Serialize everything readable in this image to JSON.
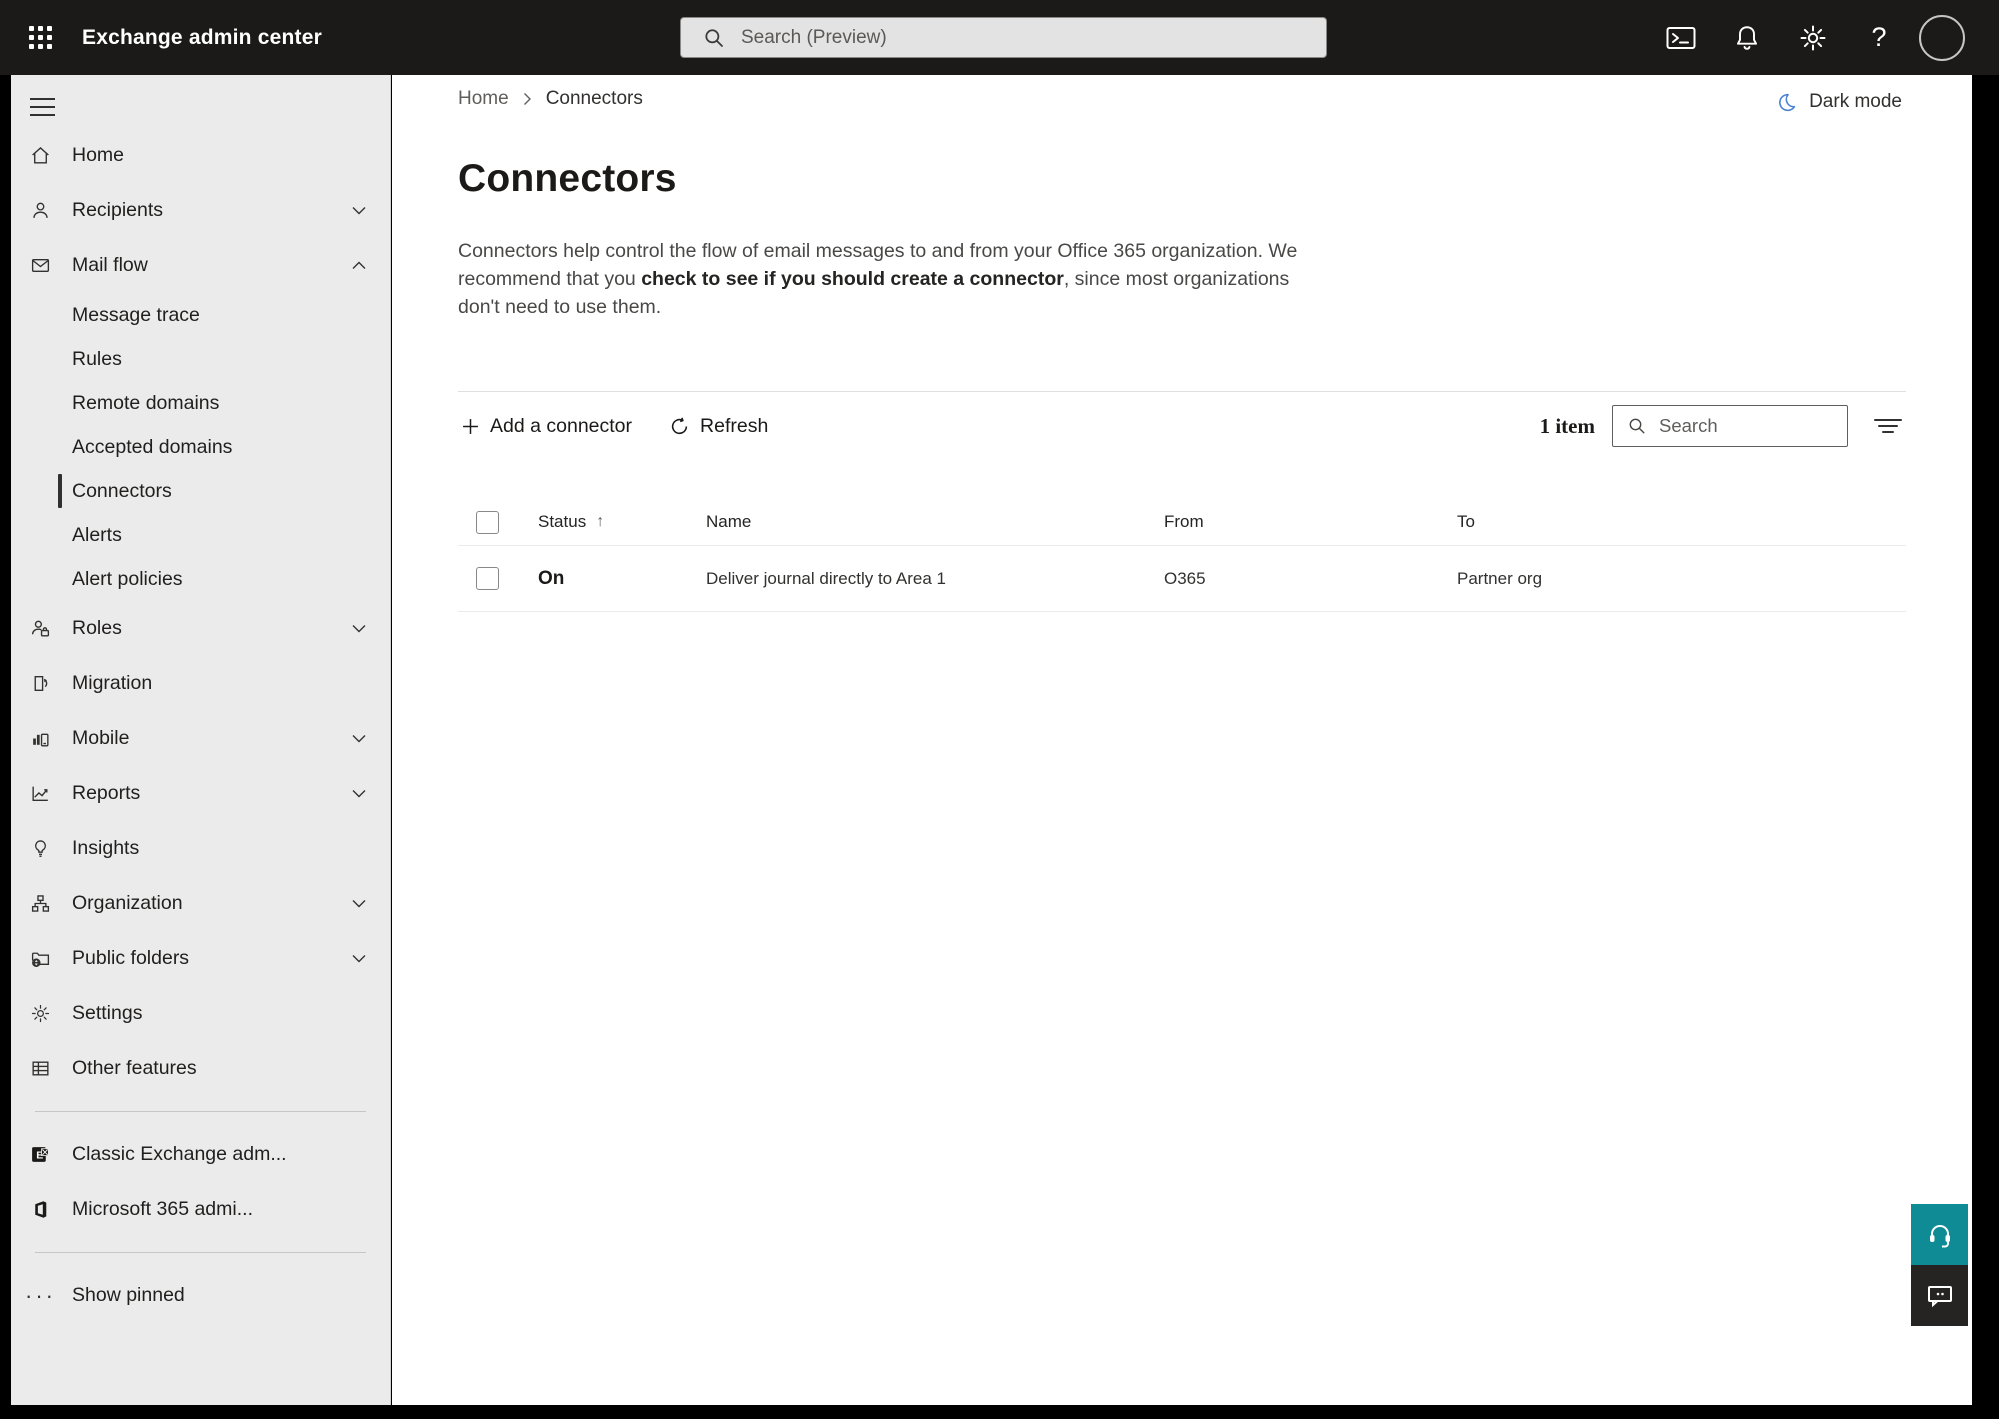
{
  "header": {
    "app_title": "Exchange admin center",
    "search_placeholder": "Search (Preview)",
    "icons": [
      "waffle",
      "terminal",
      "notifications",
      "settings",
      "help",
      "avatar"
    ],
    "help_glyph": "?"
  },
  "sidebar": {
    "items": [
      {
        "label": "Home",
        "icon": "home",
        "level": "top"
      },
      {
        "label": "Recipients",
        "icon": "person",
        "level": "top",
        "chevron": "down"
      },
      {
        "label": "Mail flow",
        "icon": "mail",
        "level": "top",
        "chevron": "up",
        "expanded": true
      },
      {
        "label": "Message trace",
        "level": "sub"
      },
      {
        "label": "Rules",
        "level": "sub"
      },
      {
        "label": "Remote domains",
        "level": "sub"
      },
      {
        "label": "Accepted domains",
        "level": "sub"
      },
      {
        "label": "Connectors",
        "level": "sub",
        "selected": true
      },
      {
        "label": "Alerts",
        "level": "sub"
      },
      {
        "label": "Alert policies",
        "level": "sub"
      },
      {
        "label": "Roles",
        "icon": "roles",
        "level": "top",
        "chevron": "down"
      },
      {
        "label": "Migration",
        "icon": "migration",
        "level": "top"
      },
      {
        "label": "Mobile",
        "icon": "mobile",
        "level": "top",
        "chevron": "down"
      },
      {
        "label": "Reports",
        "icon": "reports",
        "level": "top",
        "chevron": "down"
      },
      {
        "label": "Insights",
        "icon": "insights",
        "level": "top"
      },
      {
        "label": "Organization",
        "icon": "organization",
        "level": "top",
        "chevron": "down"
      },
      {
        "label": "Public folders",
        "icon": "public-folders",
        "level": "top",
        "chevron": "down"
      },
      {
        "label": "Settings",
        "icon": "settings",
        "level": "top"
      },
      {
        "label": "Other features",
        "icon": "other-features",
        "level": "top"
      },
      {
        "label": "Classic Exchange adm...",
        "icon": "exchange-logo",
        "level": "top"
      },
      {
        "label": "Microsoft 365 admi...",
        "icon": "m365-logo",
        "level": "top"
      },
      {
        "label": "Show pinned",
        "icon": "ellipsis",
        "level": "top"
      }
    ]
  },
  "breadcrumb": {
    "home": "Home",
    "current": "Connectors"
  },
  "dark_mode_label": "Dark mode",
  "page": {
    "title": "Connectors",
    "description_before": "Connectors help control the flow of email messages to and from your Office 365 organization. We recommend that you ",
    "description_link": "check to see if you should create a connector",
    "description_after": ", since most organizations don't need to use them."
  },
  "toolbar": {
    "add_label": "Add a connector",
    "refresh_label": "Refresh",
    "item_count": "1 item",
    "search_placeholder": "Search"
  },
  "table": {
    "columns": {
      "status": "Status",
      "name": "Name",
      "from": "From",
      "to": "To"
    },
    "sort_arrow": "↑",
    "rows": [
      {
        "status": "On",
        "name": "Deliver journal directly to Area 1",
        "from": "O365",
        "to": "Partner org"
      }
    ]
  },
  "colors": {
    "topbar_bg": "#1b1a19",
    "sidebar_bg": "#ebebeb",
    "accent_blue": "#4a80d4",
    "help_teal": "#0f8b96",
    "feedback_dark": "#252423"
  }
}
